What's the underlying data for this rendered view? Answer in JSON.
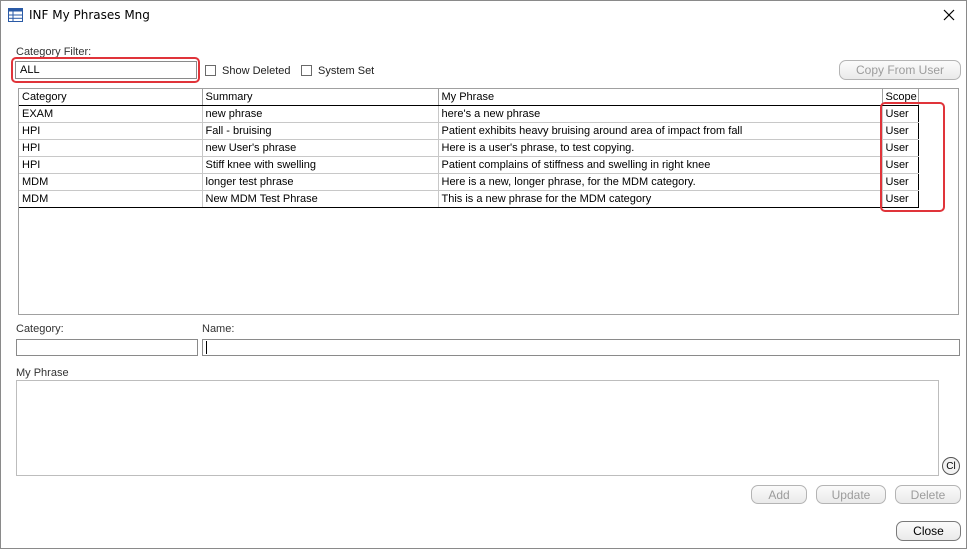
{
  "window": {
    "title": "INF My Phrases Mng"
  },
  "filter": {
    "category_filter_label": "Category Filter:",
    "category_filter_value": "ALL",
    "show_deleted_label": "Show Deleted",
    "system_set_label": "System Set",
    "copy_from_user_label": "Copy From User"
  },
  "grid": {
    "columns": [
      "Category",
      "Summary",
      "My Phrase",
      "Scope"
    ],
    "rows": [
      {
        "category": "EXAM",
        "summary": "new phrase",
        "phrase": "here's a new phrase",
        "scope": "User"
      },
      {
        "category": "HPI",
        "summary": "Fall - bruising",
        "phrase": "Patient exhibits heavy bruising around area of impact from fall",
        "scope": "User"
      },
      {
        "category": "HPI",
        "summary": "new User's phrase",
        "phrase": "Here is a user's phrase, to test copying.",
        "scope": "User"
      },
      {
        "category": "HPI",
        "summary": "Stiff knee with swelling",
        "phrase": "Patient complains of stiffness and swelling in right knee",
        "scope": "User"
      },
      {
        "category": "MDM",
        "summary": "longer test phrase",
        "phrase": "Here is a new, longer phrase, for the MDM category.",
        "scope": "User"
      },
      {
        "category": "MDM",
        "summary": "New MDM Test Phrase",
        "phrase": "This is a new phrase for the MDM category",
        "scope": "User"
      }
    ]
  },
  "editor": {
    "category_label": "Category:",
    "category_value": "",
    "name_label": "Name:",
    "name_value": "",
    "my_phrase_label": "My Phrase",
    "my_phrase_value": "",
    "cl_label": "Cl"
  },
  "actions": {
    "add_label": "Add",
    "update_label": "Update",
    "delete_label": "Delete",
    "close_label": "Close"
  },
  "colors": {
    "highlight": "#e0343a",
    "disabled_text": "#9c9c9c"
  }
}
